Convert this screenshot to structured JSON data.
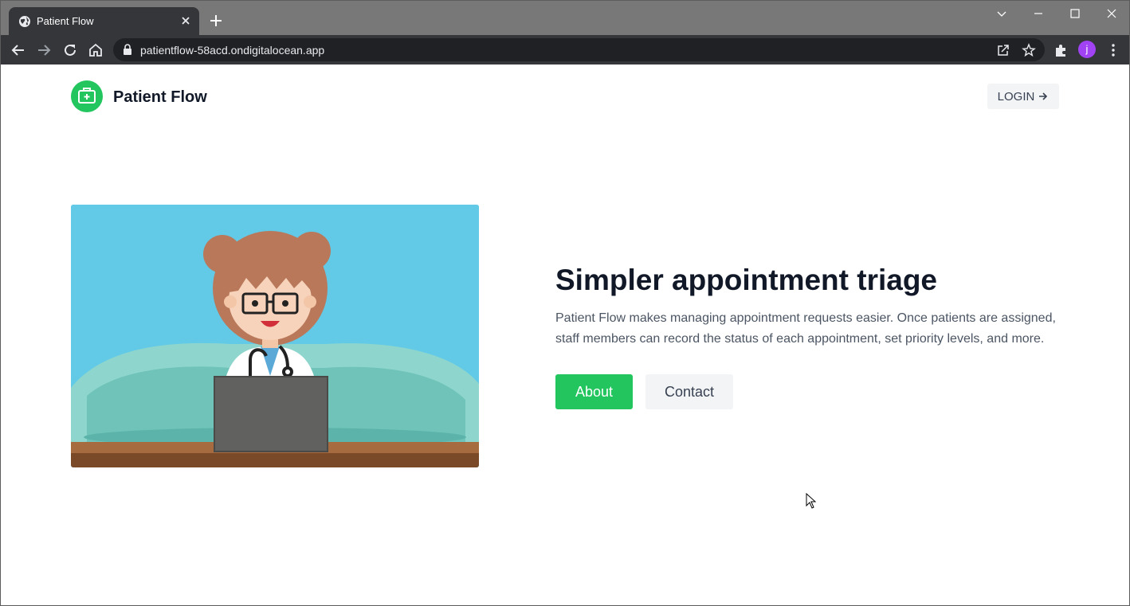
{
  "browser": {
    "tab_title": "Patient Flow",
    "url": "patientflow-58acd.ondigitalocean.app",
    "profile_initial": "j",
    "tab_bg": "#35363a",
    "frame_bg": "#787878"
  },
  "site": {
    "brand_name": "Patient Flow",
    "login_label": "LOGIN",
    "accent": "#22c55e"
  },
  "hero": {
    "headline": "Simpler appointment triage",
    "description": "Patient Flow makes managing appointment requests easier. Once patients are assigned, staff members can record the status of each appointment, set priority levels, and more.",
    "about_label": "About",
    "contact_label": "Contact"
  },
  "icons": [
    "globe-icon",
    "close-icon",
    "plus-icon",
    "chevron-down-icon",
    "minimize-icon",
    "maximize-icon",
    "back-icon",
    "forward-icon",
    "reload-icon",
    "home-icon",
    "lock-icon",
    "share-icon",
    "star-icon",
    "extensions-icon",
    "kebab-menu-icon",
    "medical-kit-icon",
    "arrow-right-icon"
  ]
}
